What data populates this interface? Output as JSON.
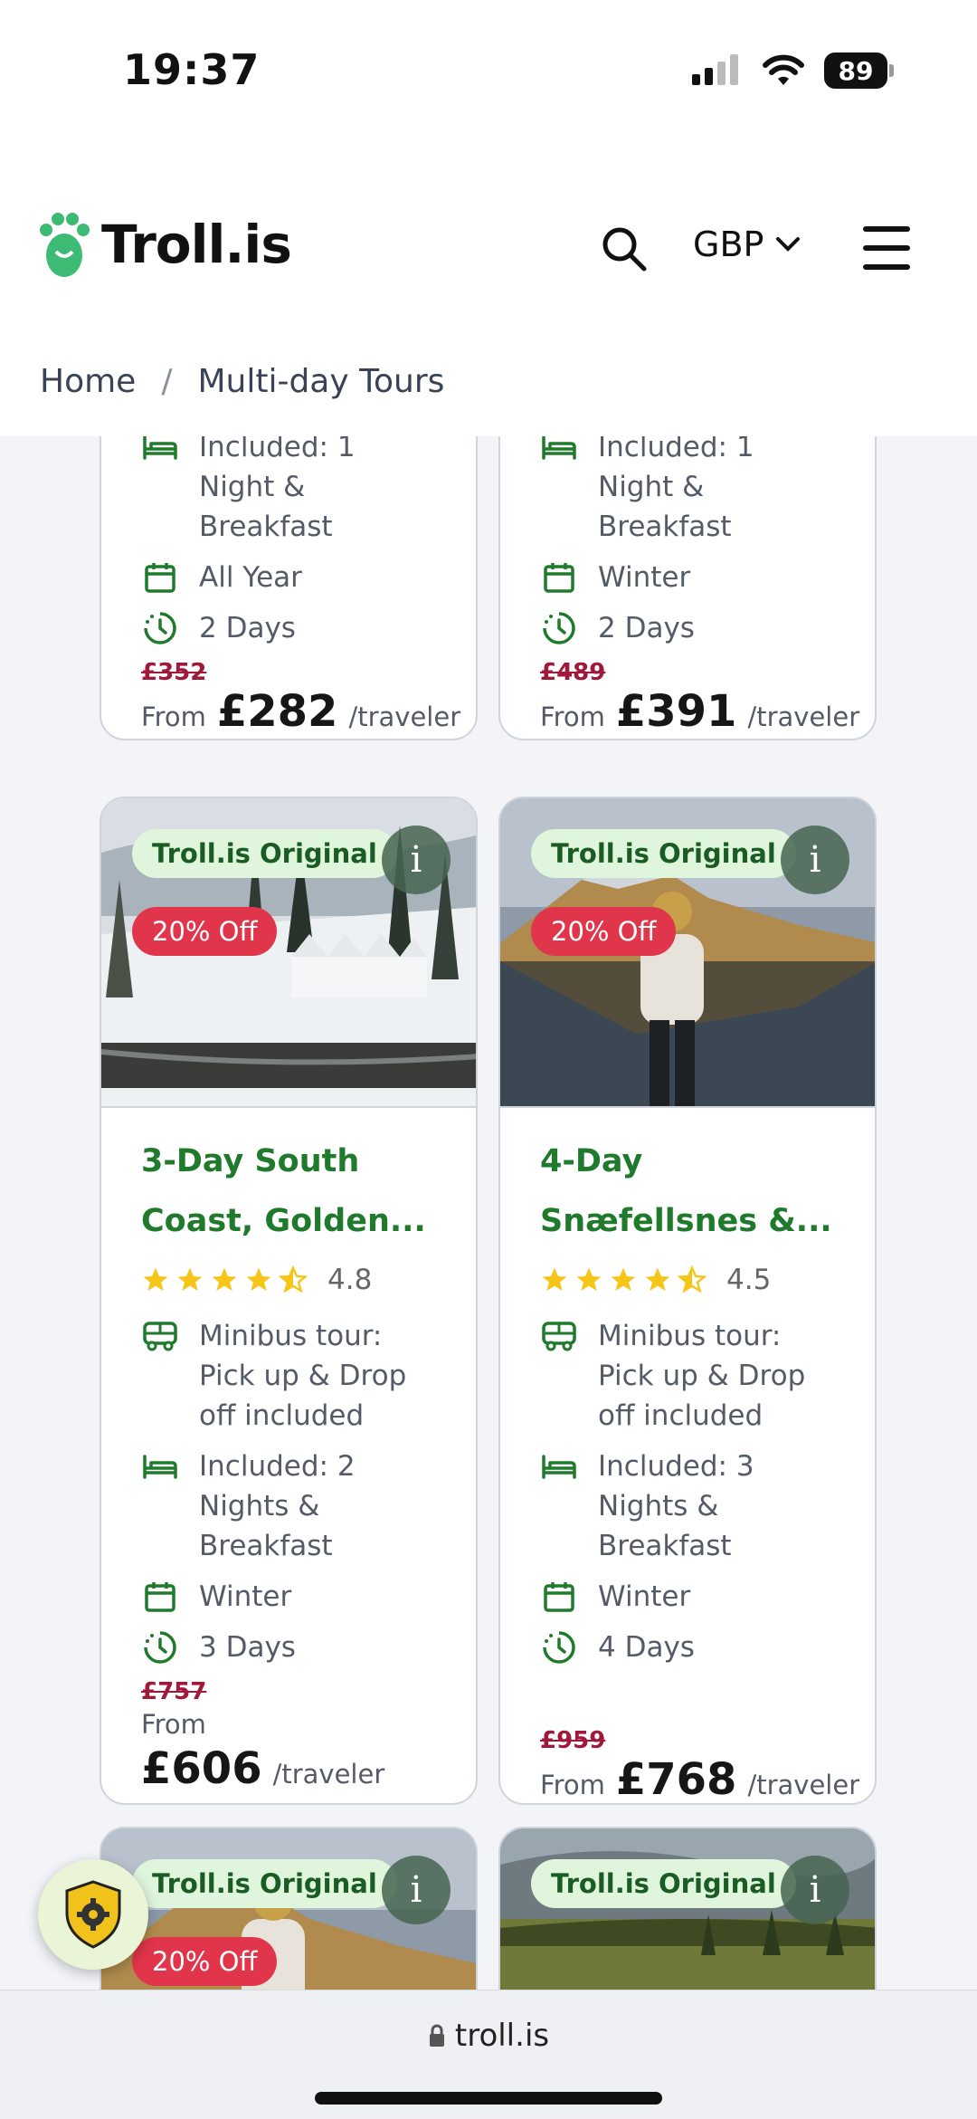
{
  "status_bar": {
    "time": "19:37",
    "battery": "89"
  },
  "header": {
    "logo_text": "Troll.is",
    "currency": "GBP"
  },
  "breadcrumb": {
    "home": "Home",
    "separator": "/",
    "current": "Multi-day Tours"
  },
  "top_cards": [
    {
      "cut_text": "included",
      "accommodation": "Included: 1 Night & Breakfast",
      "season": "All Year",
      "duration": "2 Days",
      "old_price": "£352",
      "from_label": "From",
      "price": "£282",
      "per": "/traveler"
    },
    {
      "cut_text": "included",
      "accommodation": "Included: 1 Night & Breakfast",
      "season": "Winter",
      "duration": "2 Days",
      "old_price": "£489",
      "from_label": "From",
      "price": "£391",
      "per": "/traveler"
    }
  ],
  "mid_cards": [
    {
      "badge_original": "Troll.is Original",
      "badge_discount": "20% Off",
      "info": "i",
      "title": "3-Day South Coast, Golden...",
      "rating": "4.8",
      "rating_value": 4.5,
      "transport": "Minibus tour: Pick up & Drop off included",
      "accommodation": "Included: 2 Nights & Breakfast",
      "season": "Winter",
      "duration": "3 Days",
      "old_price": "£757",
      "from_label": "From",
      "price": "£606",
      "per": "/traveler"
    },
    {
      "badge_original": "Troll.is Original",
      "badge_discount": "20% Off",
      "info": "i",
      "title": "4-Day Snæfellsnes &...",
      "rating": "4.5",
      "rating_value": 4.5,
      "transport": "Minibus tour: Pick up & Drop off included",
      "accommodation": "Included: 3 Nights & Breakfast",
      "season": "Winter",
      "duration": "4 Days",
      "old_price": "£959",
      "from_label": "From",
      "price": "£768",
      "per": "/traveler"
    }
  ],
  "bottom_cards": [
    {
      "badge_original": "Troll.is Original",
      "badge_discount": "20% Off",
      "info": "i"
    },
    {
      "badge_original": "Troll.is Original",
      "info": "i"
    }
  ],
  "browser": {
    "url": "troll.is"
  },
  "colors": {
    "brand_green": "#1f7a2c",
    "discount_red": "#e0354a",
    "star": "#f5c518"
  }
}
